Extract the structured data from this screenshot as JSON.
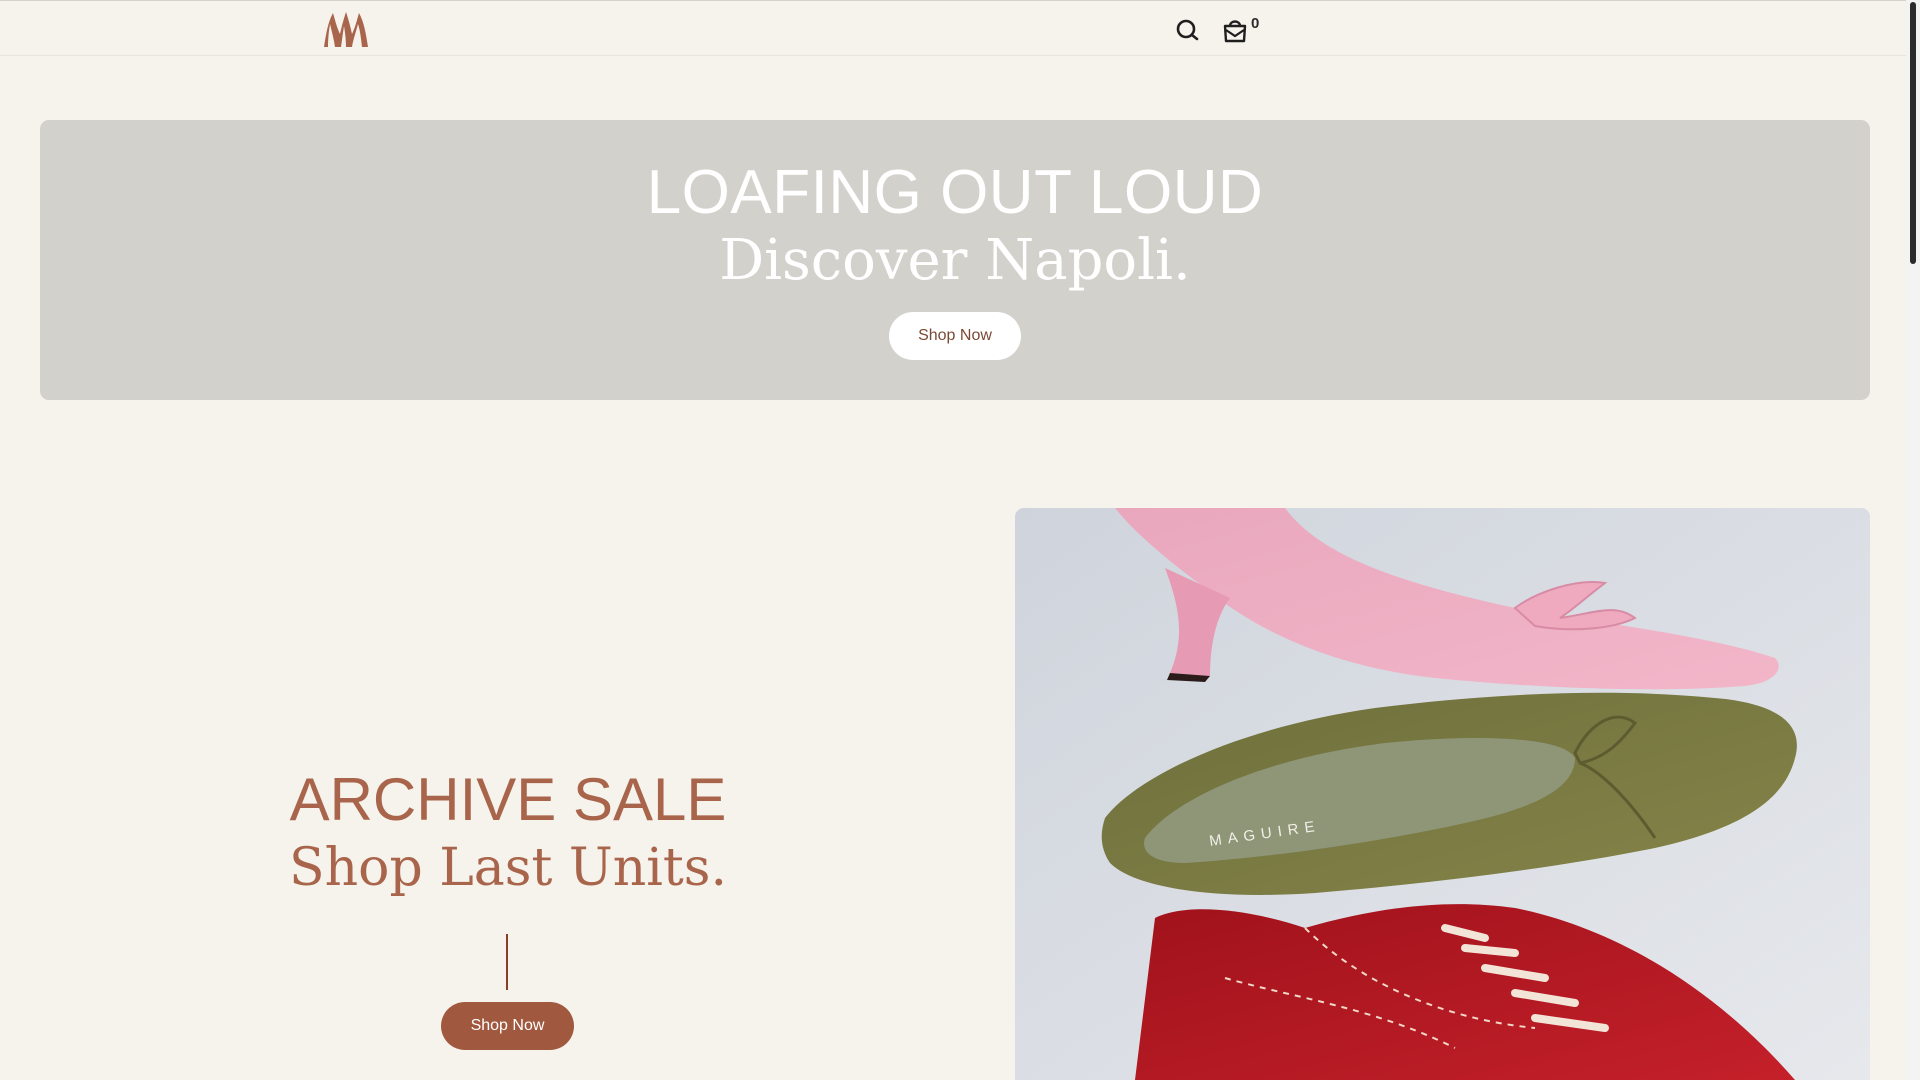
{
  "header": {
    "logo_icon": "maguire-m-logo-icon",
    "search_icon": "search-icon",
    "cart_icon": "bag-icon",
    "cart_count": "0"
  },
  "hero": {
    "title": "LOAFING OUT LOUD",
    "subtitle": "Discover Napoli.",
    "button_label": "Shop Now"
  },
  "archive": {
    "title": "ARCHIVE SALE",
    "subtitle": "Shop Last Units.",
    "button_label": "Shop Now",
    "image_brand_text": "MAGUIRE"
  },
  "colors": {
    "page_background": "#f6f2ec",
    "hero_background": "#d3d1cc",
    "brand_terracotta": "#a9654b",
    "button_fill": "#a0583f",
    "hero_button_text": "#7a4a34"
  }
}
